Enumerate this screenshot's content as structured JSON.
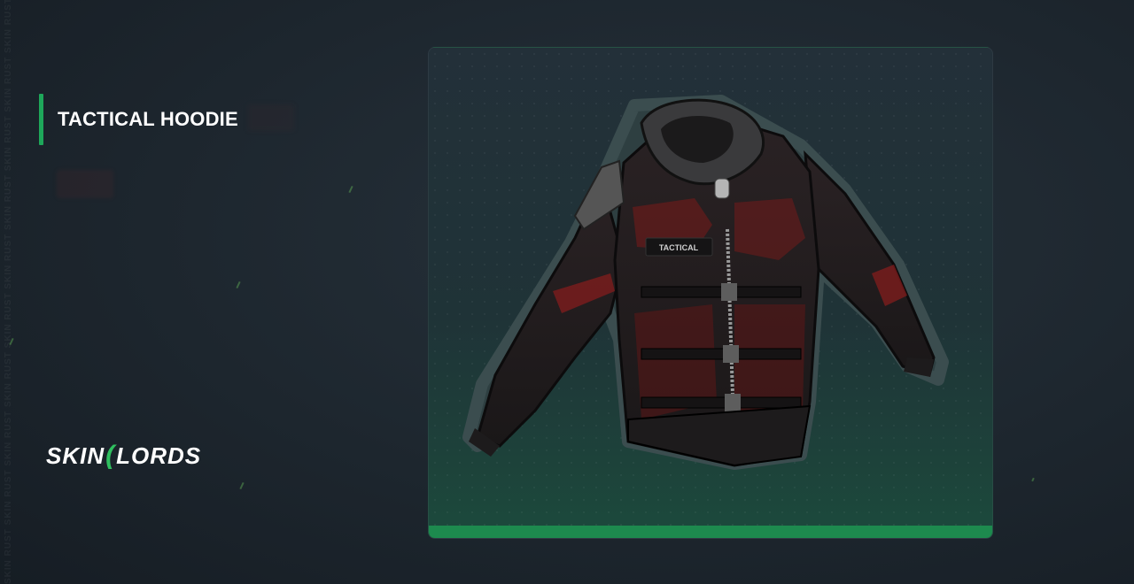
{
  "item": {
    "title": "TACTICAL HOODIE",
    "badge_text": "TACTICAL"
  },
  "brand": {
    "logo_left": "SKIN",
    "logo_right": "LORDS",
    "watermark": "SKIN RUST SKIN RUST SKIN RUST SKIN RUST SKIN RUST SKIN RUST SKIN RUST SKIN RUST SKIN RUST SKIN RUST"
  },
  "colors": {
    "accent": "#1ea75a",
    "card_bar": "#1d8a4e",
    "background": "#1d262e"
  },
  "icons": {
    "item_image": "hoodie-image"
  }
}
